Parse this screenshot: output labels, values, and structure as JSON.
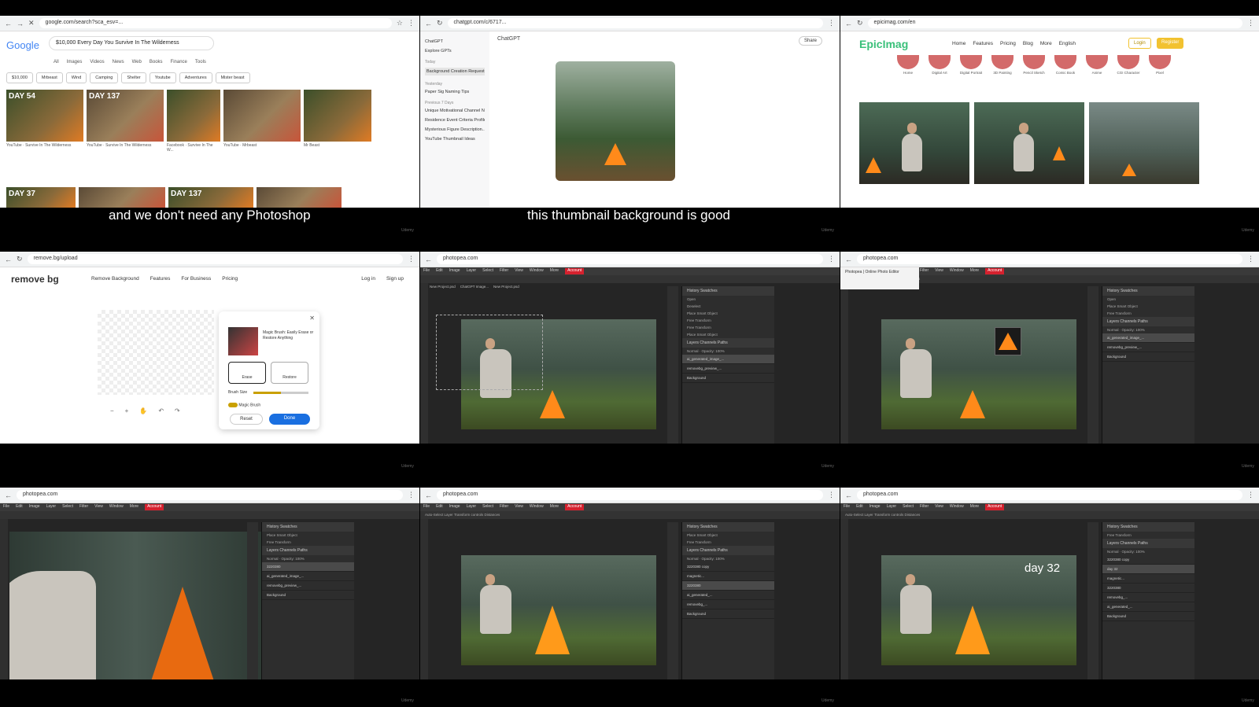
{
  "subtitles": {
    "row1_left": "and we don't need any Photoshop",
    "row1_right": "this thumbnail background is good"
  },
  "watermark": "Udemy",
  "google": {
    "url": "google.com/search?sca_esv=...",
    "logo": "Google",
    "query": "$10,000 Every Day You Survive In The Wilderness",
    "tabs": [
      "All",
      "Images",
      "Videos",
      "News",
      "Web",
      "Books",
      "Finance",
      "Tools"
    ],
    "chips": [
      "$10,000",
      "Mrbeast",
      "Wind",
      "Camping",
      "Shelter",
      "Youtube",
      "Adventures",
      "Mister beast"
    ],
    "thumb_labels": [
      "DAY 54",
      "DAY 137",
      "",
      "",
      ""
    ],
    "captions": [
      "YouTube · Survive In The Wilderness",
      "YouTube · Survive In The Wilderness",
      "Facebook · Survive In The W...",
      "YouTube · Mrbeast",
      "Mr Beast"
    ],
    "thumb_labels_row2": [
      "DAY 37",
      "",
      "DAY 137",
      ""
    ]
  },
  "chatgpt": {
    "url": "chatgpt.com/c/6717...",
    "title": "ChatGPT",
    "share": "Share",
    "side_top": [
      "ChatGPT",
      "Explore GPTs"
    ],
    "today_label": "Today",
    "today_items": [
      "Background Creation Request"
    ],
    "yesterday_label": "Yesterday",
    "yesterday_items": [
      "Paper Sig Naming Tips"
    ],
    "previous_label": "Previous 7 Days",
    "previous_items": [
      "Unique Motivational Channel Nam...",
      "Residence Event Criteria Profile",
      "Mysterious Figure Description...",
      "YouTube Thumbnail Ideas"
    ]
  },
  "epicimag": {
    "url": "epicimag.com/en",
    "logo": "EpicImag",
    "nav": [
      "Home",
      "Features",
      "Pricing",
      "Blog",
      "More",
      "English"
    ],
    "login": "Login",
    "register": "Register",
    "categories": [
      "Home",
      "Digital Art",
      "Digital Portrait",
      "3D Painting",
      "Pencil Sketch",
      "Comic Book",
      "Anime",
      "CGI Character",
      "Pixel"
    ]
  },
  "removebg": {
    "url": "remove.bg/upload",
    "logo": "remove bg",
    "nav": [
      "Remove Background",
      "Features",
      "For Business",
      "Pricing"
    ],
    "login": "Log in",
    "signup": "Sign up",
    "panel_text": "Magic Brush: Easily Erase or Restore Anything",
    "erase": "Erase",
    "restore": "Restore",
    "brush_size": "Brush Size",
    "magic_brush": "Magic Brush",
    "reset": "Reset",
    "done": "Done"
  },
  "photopea": {
    "url": "photopea.com",
    "menu": [
      "File",
      "Edit",
      "Image",
      "Layer",
      "Select",
      "Filter",
      "View",
      "Window",
      "More",
      "Account"
    ],
    "tabs": [
      "New Project.psd",
      "ChatGPT Image...",
      "New Project.psd"
    ],
    "history_header": "History   Swatches",
    "layers_header": "Layers   Channels   Paths",
    "blend": "Normal",
    "opacity": "Opacity: 100%",
    "history_a": [
      "Open",
      "Deselect",
      "Place Smart Object",
      "Free Transform",
      "Free Transform",
      "Place Smart Object"
    ],
    "layers_a": [
      "ai_generated_image_...",
      "removebg_preview_...",
      "Background"
    ],
    "tooltip": "Photopea | Online Photo Editor",
    "layers_c": [
      "3220380 copy",
      "day 32",
      "magnetic...",
      "3220380",
      "removebg_...",
      "ai_generated_...",
      "Background"
    ],
    "day_text": "day 32",
    "options_bar": "Auto-Select  Layer  Transform controls  Distances"
  }
}
